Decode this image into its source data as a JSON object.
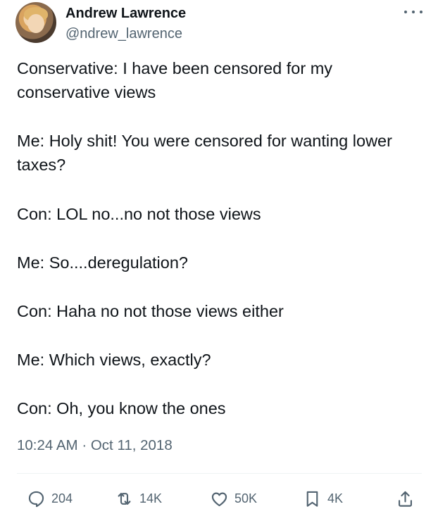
{
  "author": {
    "name": "Andrew Lawrence",
    "handle": "@ndrew_lawrence"
  },
  "tweet": {
    "paragraphs": [
      "Conservative: I have been censored for my conservative views",
      "Me: Holy shit! You were censored for wanting lower taxes?",
      "Con: LOL no...no not those views",
      "Me: So....deregulation?",
      "Con: Haha no not those views either",
      "Me: Which views, exactly?",
      "Con: Oh, you know the ones"
    ],
    "time": "10:24 AM",
    "separator": "·",
    "date": "Oct 11, 2018"
  },
  "actions": {
    "replies": "204",
    "retweets": "14K",
    "likes": "50K",
    "bookmarks": "4K"
  },
  "colors": {
    "text": "#0f1419",
    "secondary": "#536471",
    "divider": "#eff3f4"
  }
}
